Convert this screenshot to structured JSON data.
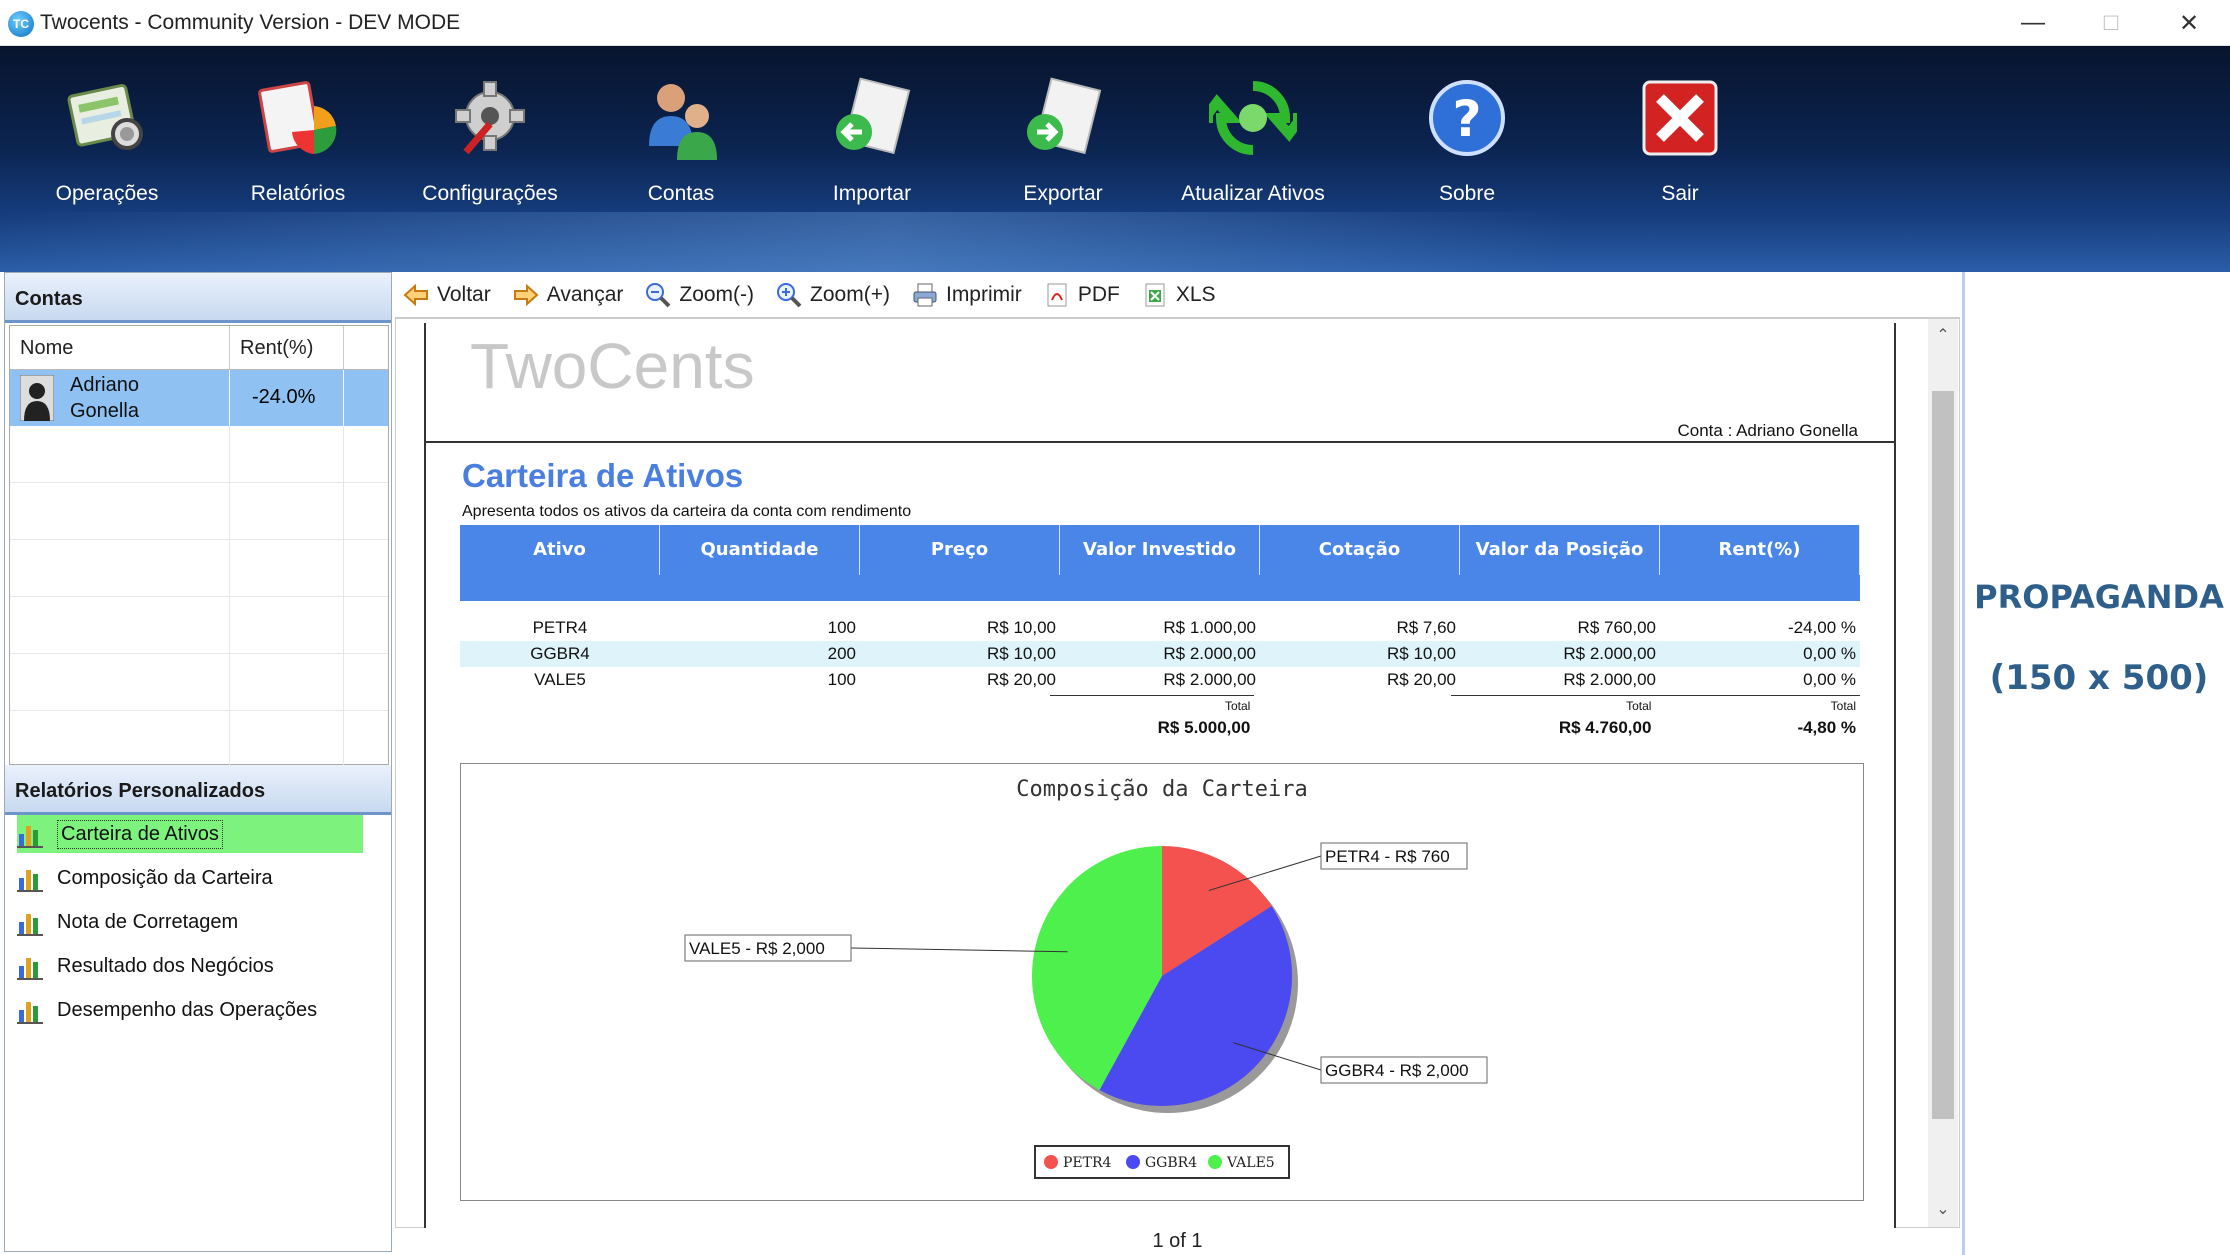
{
  "window": {
    "title": "Twocents - Community Version - DEV MODE",
    "app_icon": "TC"
  },
  "ribbon": [
    {
      "id": "operacoes",
      "label": "Operações",
      "icon": "operations-icon"
    },
    {
      "id": "relatorios",
      "label": "Relatórios",
      "icon": "reports-icon"
    },
    {
      "id": "configuracoes",
      "label": "Configurações",
      "icon": "gear-icon"
    },
    {
      "id": "contas",
      "label": "Contas",
      "icon": "users-icon"
    },
    {
      "id": "importar",
      "label": "Importar",
      "icon": "import-icon"
    },
    {
      "id": "exportar",
      "label": "Exportar",
      "icon": "export-icon"
    },
    {
      "id": "atualizar",
      "label": "Atualizar Ativos",
      "icon": "refresh-icon"
    },
    {
      "id": "sobre",
      "label": "Sobre",
      "icon": "help-icon"
    },
    {
      "id": "sair",
      "label": "Sair",
      "icon": "close-icon"
    }
  ],
  "contas": {
    "title": "Contas",
    "col_nome": "Nome",
    "col_rent": "Rent(%)",
    "rows": [
      {
        "nome": "Adriano Gonella",
        "rent": "-24.0%"
      }
    ]
  },
  "relatorios": {
    "title": "Relatórios Personalizados",
    "items": [
      "Carteira de Ativos",
      "Composição da Carteira",
      "Nota de Corretagem",
      "Resultado dos Negócios",
      "Desempenho das Operações"
    ],
    "selected": "Carteira de Ativos"
  },
  "toolbar": {
    "voltar": "Voltar",
    "avancar": "Avançar",
    "zoom_out": "Zoom(-)",
    "zoom_in": "Zoom(+)",
    "imprimir": "Imprimir",
    "pdf": "PDF",
    "xls": "XLS"
  },
  "report": {
    "logo": "TwoCents",
    "conta": "Conta : Adriano Gonella",
    "title": "Carteira de Ativos",
    "subtitle": "Apresenta todos os ativos da carteira da conta com rendimento",
    "columns": [
      "Ativo",
      "Quantidade",
      "Preço",
      "Valor Investido",
      "Cotação",
      "Valor da Posição",
      "Rent(%)"
    ],
    "rows": [
      [
        "PETR4",
        "100",
        "R$ 10,00",
        "R$ 1.000,00",
        "R$ 7,60",
        "R$ 760,00",
        "-24,00 %"
      ],
      [
        "GGBR4",
        "200",
        "R$ 10,00",
        "R$ 2.000,00",
        "R$ 10,00",
        "R$ 2.000,00",
        "0,00 %"
      ],
      [
        "VALE5",
        "100",
        "R$ 20,00",
        "R$ 2.000,00",
        "R$ 20,00",
        "R$ 2.000,00",
        "0,00 %"
      ]
    ],
    "total_label": "Total",
    "total_investido": "R$ 5.000,00",
    "total_posicao": "R$ 4.760,00",
    "total_rent": "-4,80 %"
  },
  "chart_data": {
    "type": "pie",
    "title": "Composição da Carteira",
    "categories": [
      "PETR4",
      "GGBR4",
      "VALE5"
    ],
    "values": [
      760,
      2000,
      2000
    ],
    "labels": [
      "PETR4 - R$ 760",
      "GGBR4 - R$ 2,000",
      "VALE5 - R$ 2,000"
    ],
    "colors": [
      "#f4524f",
      "#4a4af0",
      "#4df04d"
    ],
    "legend": "bottom"
  },
  "ad": {
    "line1": "PROPAGANDA",
    "line2": "(150 x 500)"
  },
  "pager": {
    "text": "1 of 1"
  }
}
